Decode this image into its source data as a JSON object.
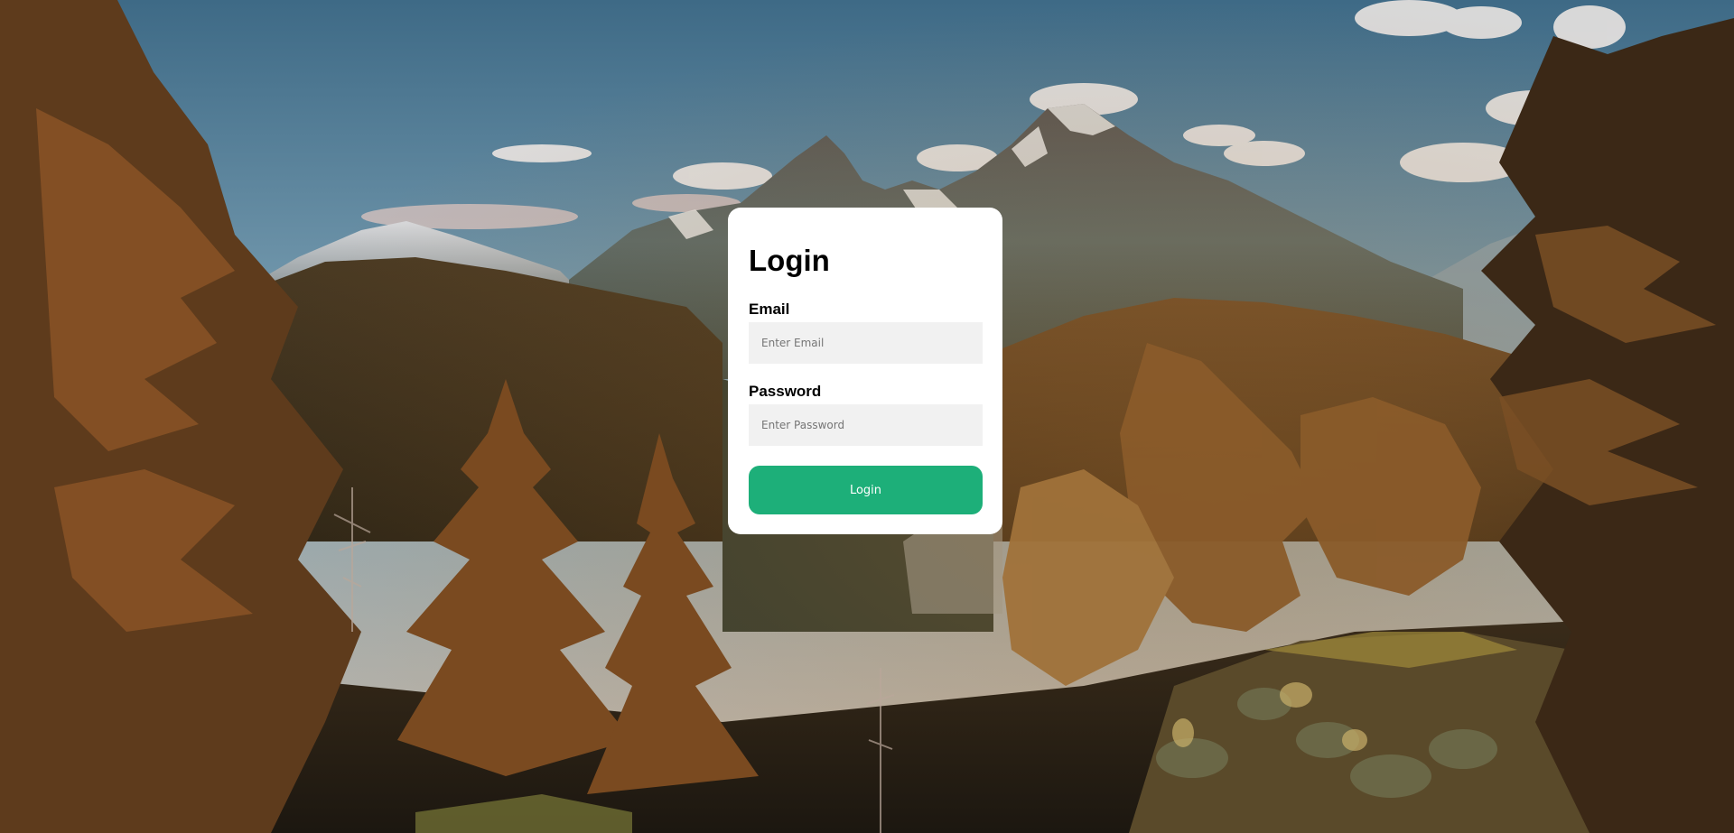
{
  "login": {
    "title": "Login",
    "email_label": "Email",
    "email_placeholder": "Enter Email",
    "email_value": "",
    "password_label": "Password",
    "password_placeholder": "Enter Password",
    "password_value": "",
    "submit_label": "Login"
  },
  "background": {
    "description_icon": "mountain-forest-landscape-image"
  },
  "colors": {
    "accent": "#1daf79",
    "card": "#ffffff",
    "input_bg": "#f1f1f1"
  }
}
